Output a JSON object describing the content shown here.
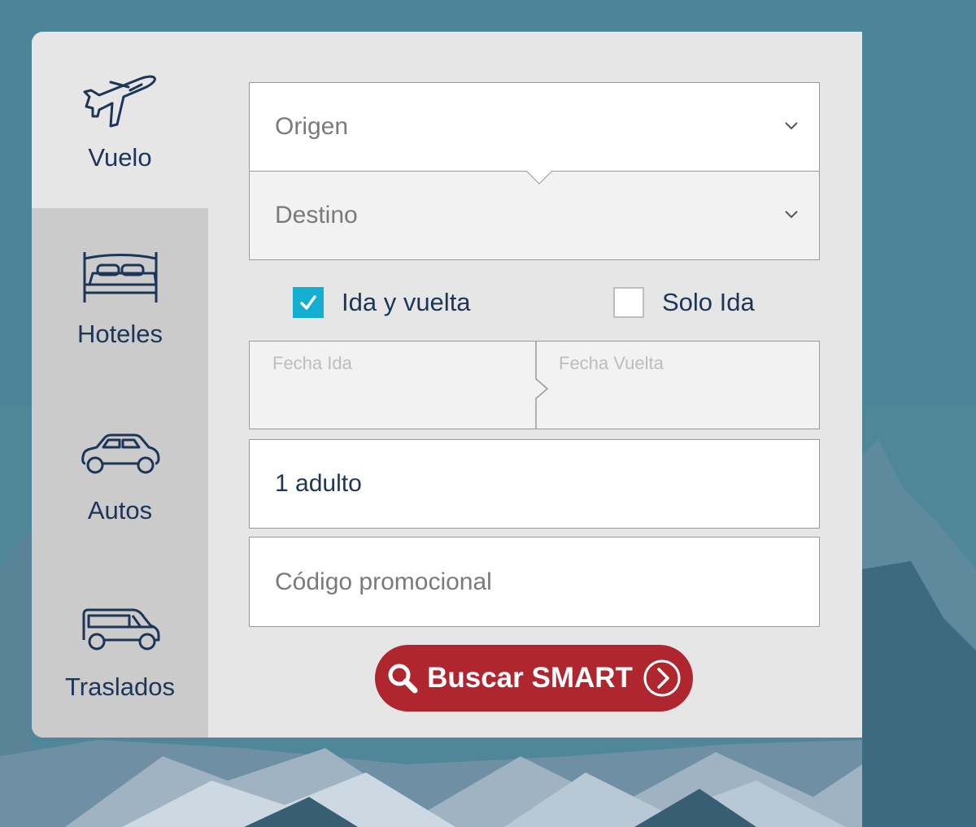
{
  "colors": {
    "accent": "#b0262e",
    "checkbox": "#14aed0",
    "label": "#1d3557",
    "panel": "#e6e6e6",
    "sidebar": "#cbcbcb"
  },
  "tabs": [
    {
      "label": "Vuelo",
      "icon": "airplane-icon",
      "active": true
    },
    {
      "label": "Hoteles",
      "icon": "bed-icon",
      "active": false
    },
    {
      "label": "Autos",
      "icon": "car-icon",
      "active": false
    },
    {
      "label": "Traslados",
      "icon": "van-icon",
      "active": false
    }
  ],
  "form": {
    "origin_placeholder": "Origen",
    "destination_placeholder": "Destino",
    "trip_round_label": "Ida y vuelta",
    "trip_round_checked": true,
    "trip_oneway_label": "Solo Ida",
    "trip_oneway_checked": false,
    "date_out_placeholder": "Fecha Ida",
    "date_return_placeholder": "Fecha Vuelta",
    "passengers_value": "1 adulto",
    "promo_placeholder": "Código promocional",
    "search_button_label": "Buscar SMART"
  }
}
